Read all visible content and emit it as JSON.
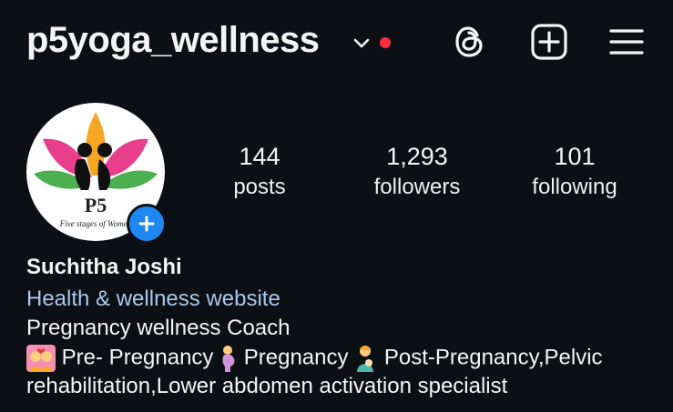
{
  "header": {
    "username": "p5yoga_wellness",
    "icons": [
      "chevron-down-icon",
      "notification-dot",
      "threads-icon",
      "create-post-icon",
      "menu-icon"
    ]
  },
  "avatar": {
    "logo_text": "P5",
    "logo_tagline": "Five stages of Women"
  },
  "stats": [
    {
      "value": "144",
      "label": "posts"
    },
    {
      "value": "1,293",
      "label": "followers"
    },
    {
      "value": "101",
      "label": "following"
    }
  ],
  "profile": {
    "display_name": "Suchitha Joshi",
    "category": "Health & wellness website",
    "bio_line1": "Pregnancy wellness Coach",
    "bio_line2_a": "Pre- Pregnancy",
    "bio_line2_b": "Pregnancy",
    "bio_line2_c": "Post-Pregnancy,Pelvic",
    "bio_line3": "rehabilitation,Lower abdomen activation specialist"
  },
  "colors": {
    "background": "#0c0f14",
    "text": "#f5f5f5",
    "link": "#a8c8f0",
    "notification_dot": "#ff2d3b",
    "add_badge": "#1e88f0"
  }
}
